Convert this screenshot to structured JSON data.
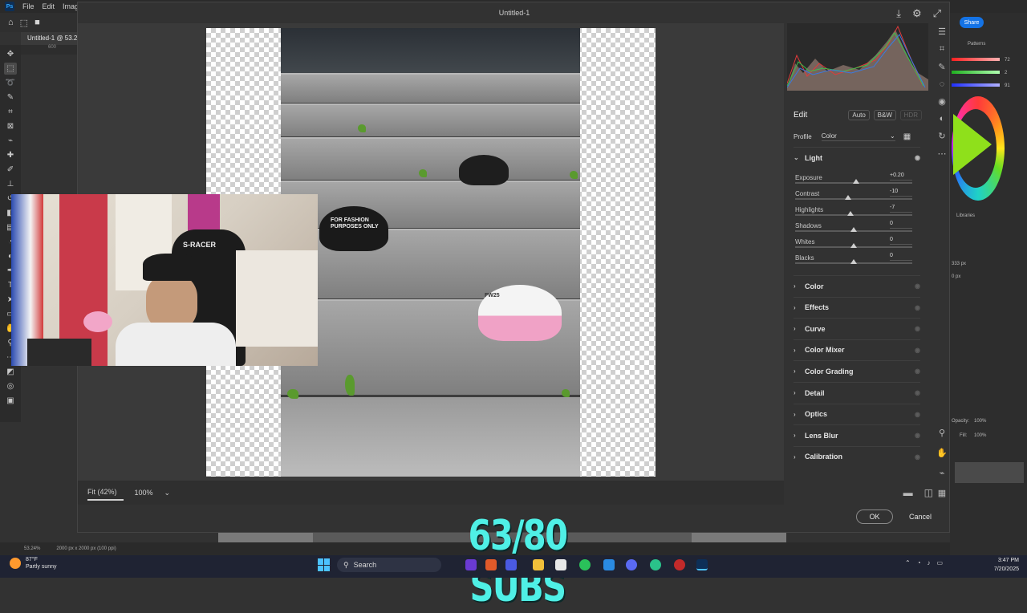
{
  "menubar": {
    "items": [
      "File",
      "Edit",
      "Image"
    ]
  },
  "document": {
    "tab_label": "Untitled-1 @ 53.2",
    "ruler_mark": "600"
  },
  "dialog": {
    "title": "Untitled-1",
    "zoom_fit": "Fit (42%)",
    "zoom_level": "100%",
    "ok_label": "OK",
    "cancel_label": "Cancel"
  },
  "edit_panel": {
    "header": "Edit",
    "buttons": [
      "Auto",
      "B&W",
      "HDR"
    ],
    "profile_label": "Profile",
    "profile_value": "Color",
    "light_section": "Light",
    "sliders": [
      {
        "label": "Exposure",
        "value": "+0.20",
        "level": 0.52
      },
      {
        "label": "Contrast",
        "value": "-10",
        "level": 0.45
      },
      {
        "label": "Highlights",
        "value": "-7",
        "level": 0.47
      },
      {
        "label": "Shadows",
        "value": "0",
        "level": 0.5
      },
      {
        "label": "Whites",
        "value": "0",
        "level": 0.5
      },
      {
        "label": "Blacks",
        "value": "0",
        "level": 0.5
      }
    ],
    "sections": [
      "Color",
      "Effects",
      "Curve",
      "Color Mixer",
      "Color Grading",
      "Detail",
      "Optics",
      "Lens Blur",
      "Calibration"
    ]
  },
  "right_panels": {
    "share_label": "Share",
    "patterns_label": "Patterns",
    "libraries_label": "Libraries",
    "rgb_values": [
      "72",
      "2",
      "91"
    ],
    "width_value": "333 px",
    "offset_value": "0 px",
    "opacity_label": "Opacity:",
    "opacity_value": "100%",
    "fill_label": "Fill:",
    "fill_value": "100%"
  },
  "status": {
    "zoom": "53.24%",
    "doc_size": "2000 px x 2000 px (100 ppi)"
  },
  "overlay": {
    "subs_text": "63/80 SUBS"
  },
  "photo": {
    "caps": [
      "FOR FASHION PURPOSES ONLY",
      "FW25"
    ]
  },
  "webcam": {
    "chair_brand": "S-RACER"
  },
  "taskbar": {
    "weather_temp": "87°F",
    "weather_desc": "Partly sunny",
    "search_label": "Search",
    "time": "3:47 PM",
    "date": "7/20/2025"
  },
  "colors": {
    "accent": "#1473e6",
    "subs": "#4ff0e6"
  }
}
